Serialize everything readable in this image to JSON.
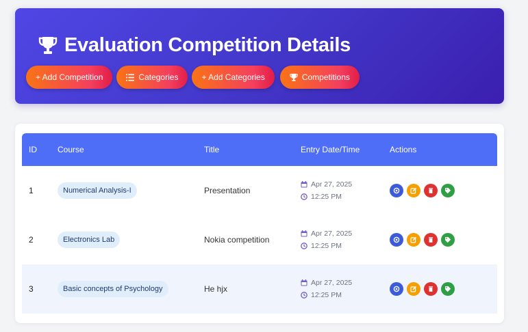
{
  "header": {
    "title": "Evaluation Competition Details",
    "buttons": {
      "add_competition": "+ Add Competition",
      "categories": "Categories",
      "add_categories": "+ Add Categories",
      "competitions": "Competitions"
    }
  },
  "table": {
    "columns": {
      "id": "ID",
      "course": "Course",
      "title": "Title",
      "entry": "Entry Date/Time",
      "actions": "Actions"
    },
    "rows": [
      {
        "id": "1",
        "course": "Numerical Analysis-I",
        "title": "Presentation",
        "date": "Apr 27, 2025",
        "time": "12:25 PM"
      },
      {
        "id": "2",
        "course": "Electronics Lab",
        "title": "Nokia competition",
        "date": "Apr 27, 2025",
        "time": "12:25 PM"
      },
      {
        "id": "3",
        "course": "Basic concepts of Psychology",
        "title": "He hjx",
        "date": "Apr 27, 2025",
        "time": "12:25 PM"
      }
    ]
  },
  "colors": {
    "header_gradient_start": "#4f46e5",
    "header_gradient_end": "#3b1fb0",
    "button_gradient_start": "#f97316",
    "button_gradient_end": "#e11d48",
    "table_header": "#4f6ef7",
    "action_view": "#3b5bdb",
    "action_edit": "#f59f00",
    "action_delete": "#e03131",
    "action_tag": "#2f9e44"
  },
  "icons": [
    "trophy-icon",
    "plus-icon",
    "list-icon",
    "calendar-icon",
    "clock-icon",
    "view-icon",
    "edit-icon",
    "delete-icon",
    "tag-icon"
  ]
}
